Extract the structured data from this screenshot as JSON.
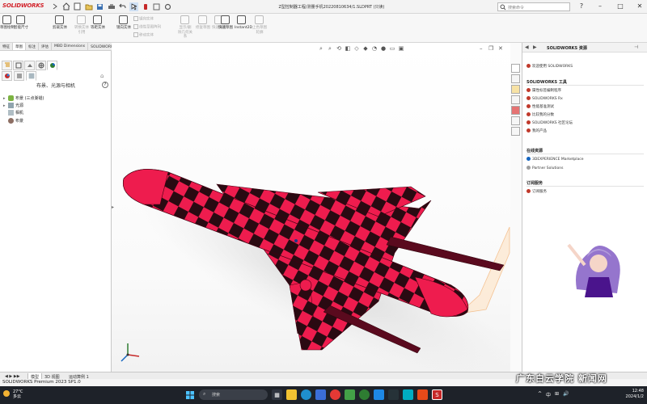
{
  "app": {
    "brand": "SOLIDWORKS",
    "document_title": "Z型控制器工程/测量手机20220810634/1.SLDPRT (只读)",
    "search_placeholder": "搜索命令",
    "window_controls": [
      "?",
      "–",
      "□",
      "✕"
    ]
  },
  "ribbon": {
    "buttons": [
      {
        "label": "草图绘制"
      },
      {
        "label": "智能尺寸"
      },
      {
        "label": "剪裁实体"
      },
      {
        "label": "转换实体引用"
      },
      {
        "label": "等距实体"
      },
      {
        "label": "镜向实体"
      },
      {
        "label": "线性草图阵列"
      },
      {
        "label": "移动实体"
      },
      {
        "label": "显示/删除几何关系"
      },
      {
        "label": "修复草图"
      },
      {
        "label": "快速捕捉"
      },
      {
        "label": "快速草图"
      },
      {
        "label": "Instant2D"
      },
      {
        "label": "上色草图轮廓"
      }
    ],
    "small_items": [
      "镜向实体",
      "线性草图阵列",
      "移动实体"
    ]
  },
  "command_tabs": [
    "特征",
    "草图",
    "标注",
    "评估",
    "MBD Dimensions",
    "SOLIDWORKS 插件",
    "MBD"
  ],
  "left_panel": {
    "title": "布景、光源与相机",
    "tree": [
      {
        "label": "布景 (三点渐褪)",
        "expand": "▸"
      },
      {
        "label": "光源",
        "expand": "▸"
      },
      {
        "label": "相机",
        "expand": ""
      },
      {
        "label": "布景",
        "expand": ""
      }
    ]
  },
  "right_panel": {
    "title": "SOLIDWORKS 资源",
    "welcome": "欢迎使用 SOLIDWORKS",
    "sections": [
      {
        "heading": "SOLIDWORKS 工具",
        "items": [
          "属性标签编制程序",
          "SOLIDWORKS Rx",
          "性能基准测试",
          "比较我的分数",
          "SOLIDWORKS 社区论坛",
          "我的产品"
        ]
      },
      {
        "heading": "在线资源",
        "items": [
          "3DEXPERIENCE Marketplace",
          "Partner Solutions"
        ]
      },
      {
        "heading": "订阅服务",
        "items": [
          "订阅服务"
        ]
      }
    ],
    "colors": {
      "accent": "#c0392b"
    }
  },
  "bottom_tabs": [
    "模型",
    "3D 视图",
    "运动算例 1"
  ],
  "status": {
    "text": "SOLIDWORKS Premium 2023 SP1.0"
  },
  "taskbar": {
    "weather_temp": "27°C",
    "weather_desc": "多云",
    "search": "搜索",
    "tray": [
      "^",
      "中",
      "⊞",
      "🔊"
    ],
    "time": "12:48",
    "date": "2024/1/2",
    "watermark": "广东白云学院  新闻网"
  },
  "model": {
    "name": "checkered jet model",
    "colors": {
      "checker_red": "#ee1c4e",
      "checker_dark": "#2a0a12"
    }
  }
}
